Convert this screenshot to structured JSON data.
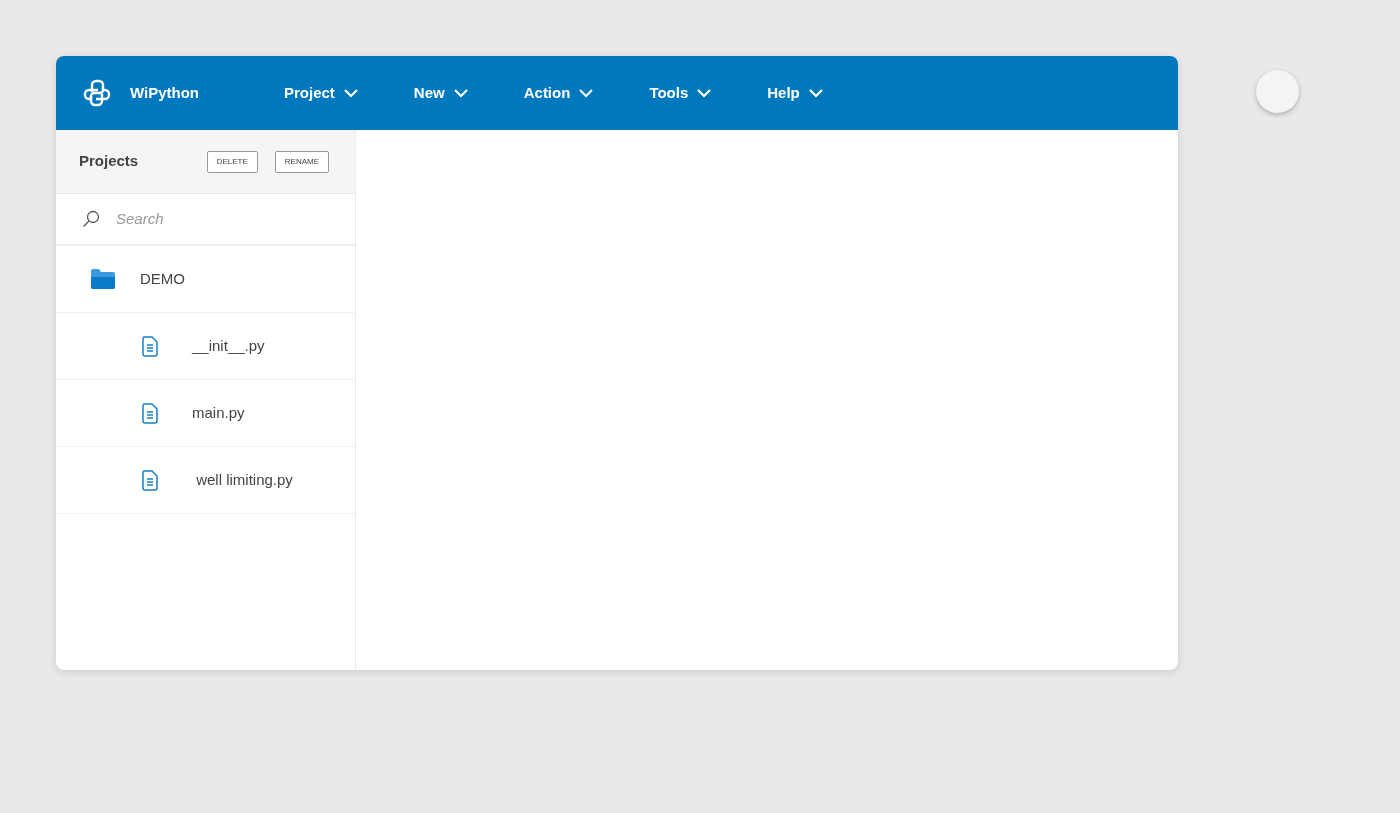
{
  "app": {
    "title": "WiPython"
  },
  "menu": [
    {
      "label": "Project"
    },
    {
      "label": "New"
    },
    {
      "label": "Action"
    },
    {
      "label": "Tools"
    },
    {
      "label": "Help"
    }
  ],
  "sidebar": {
    "title": "Projects",
    "buttons": [
      "DELETE",
      "RENAME"
    ],
    "search": {
      "placeholder": "Search"
    },
    "tree": [
      {
        "kind": "folder",
        "label": "DEMO",
        "children": [
          {
            "kind": "file",
            "label": "__init__.py"
          },
          {
            "kind": "file",
            "label": "main.py"
          },
          {
            "kind": "file",
            "label": " well limiting.py"
          }
        ]
      }
    ]
  }
}
